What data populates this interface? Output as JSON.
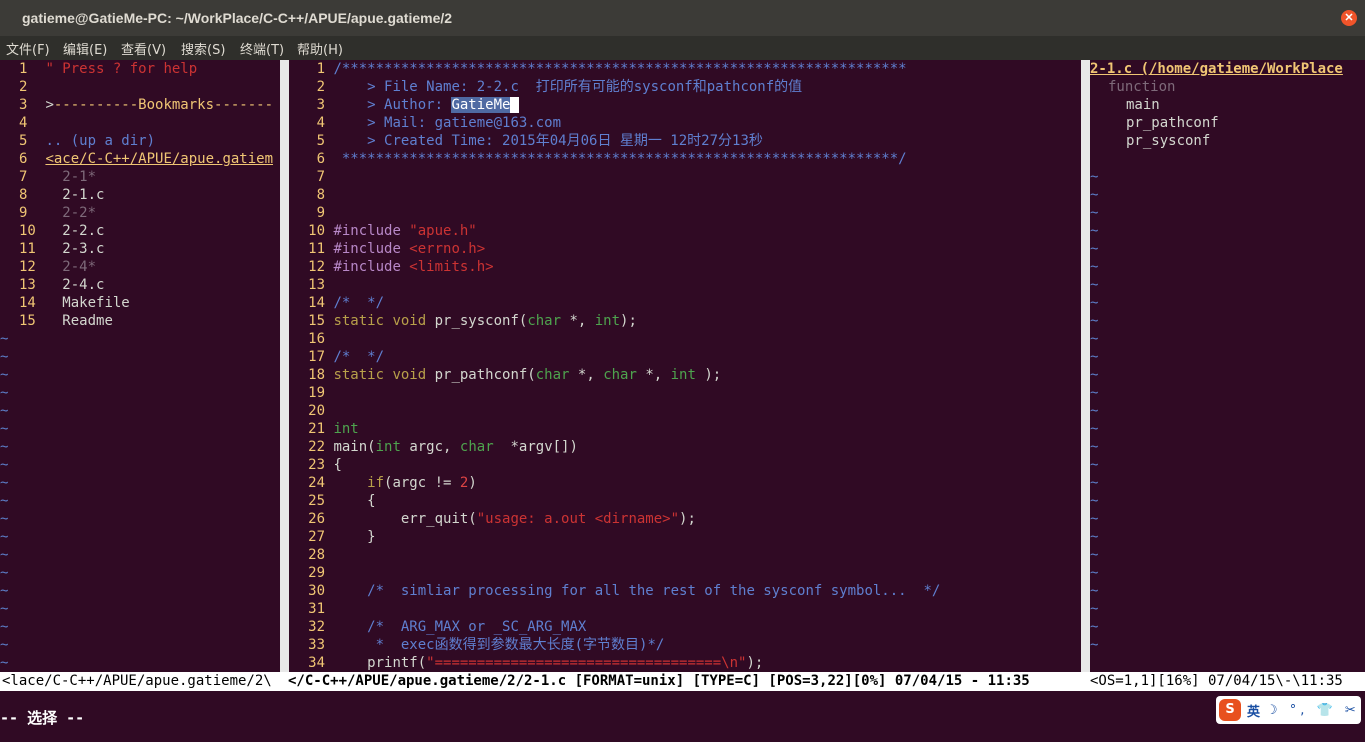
{
  "window": {
    "title": "gatieme@GatieMe-PC: ~/WorkPlace/C-C++/APUE/apue.gatieme/2"
  },
  "menu": [
    "文件(F)",
    "编辑(E)",
    "查看(V)",
    "搜索(S)",
    "终端(T)",
    "帮助(H)"
  ],
  "left_pane": {
    "lines": [
      {
        "n": "1",
        "segs": [
          {
            "t": "\" Press ? for help",
            "c": "str"
          }
        ]
      },
      {
        "n": "2",
        "segs": []
      },
      {
        "n": "3",
        "segs": [
          {
            "t": ">",
            "c": ""
          },
          {
            "t": "----------Bookmarks-------",
            "c": "bookmarks"
          }
        ]
      },
      {
        "n": "4",
        "segs": []
      },
      {
        "n": "5",
        "segs": [
          {
            "t": ".. (up a dir)",
            "c": "cmt"
          }
        ]
      },
      {
        "n": "6",
        "segs": [
          {
            "t": "<ace/C-C++/APUE/apue.gatiem",
            "c": "udir"
          }
        ]
      },
      {
        "n": "7",
        "segs": [
          {
            "t": "  2-1*",
            "c": "dim"
          }
        ]
      },
      {
        "n": "8",
        "segs": [
          {
            "t": "  2-1.c",
            "c": ""
          }
        ]
      },
      {
        "n": "9",
        "segs": [
          {
            "t": "  2-2*",
            "c": "dim"
          }
        ]
      },
      {
        "n": "10",
        "segs": [
          {
            "t": "  2-2.c",
            "c": ""
          }
        ]
      },
      {
        "n": "11",
        "segs": [
          {
            "t": "  2-3.c",
            "c": ""
          }
        ]
      },
      {
        "n": "12",
        "segs": [
          {
            "t": "  2-4*",
            "c": "dim"
          }
        ]
      },
      {
        "n": "13",
        "segs": [
          {
            "t": "  2-4.c",
            "c": ""
          }
        ]
      },
      {
        "n": "14",
        "segs": [
          {
            "t": "  Makefile",
            "c": ""
          }
        ]
      },
      {
        "n": "15",
        "segs": [
          {
            "t": "  Readme",
            "c": ""
          }
        ]
      }
    ]
  },
  "center_pane": {
    "lines": [
      {
        "n": "1",
        "segs": [
          {
            "t": "/*******************************************************************",
            "c": "cmt"
          }
        ]
      },
      {
        "n": "2",
        "segs": [
          {
            "t": "    > File Name: 2-2.c  打印所有可能的sysconf和pathconf的值",
            "c": "cmt"
          }
        ]
      },
      {
        "n": "3",
        "segs": [
          {
            "t": "    > Author: ",
            "c": "cmt"
          },
          {
            "t": "GatieMe",
            "c": "sel"
          },
          {
            "t": " ",
            "c": "cursor"
          }
        ]
      },
      {
        "n": "4",
        "segs": [
          {
            "t": "    > Mail: gatieme@163.com",
            "c": "cmt"
          }
        ]
      },
      {
        "n": "5",
        "segs": [
          {
            "t": "    > Created Time: 2015年04月06日 星期一 12时27分13秒",
            "c": "cmt"
          }
        ]
      },
      {
        "n": "6",
        "segs": [
          {
            "t": " ******************************************************************/",
            "c": "cmt"
          }
        ]
      },
      {
        "n": "7",
        "segs": []
      },
      {
        "n": "8",
        "segs": []
      },
      {
        "n": "9",
        "segs": []
      },
      {
        "n": "10",
        "segs": [
          {
            "t": "#include ",
            "c": "pre"
          },
          {
            "t": "\"apue.h\"",
            "c": "str"
          }
        ]
      },
      {
        "n": "11",
        "segs": [
          {
            "t": "#include ",
            "c": "pre"
          },
          {
            "t": "<errno.h>",
            "c": "str"
          }
        ]
      },
      {
        "n": "12",
        "segs": [
          {
            "t": "#include ",
            "c": "pre"
          },
          {
            "t": "<limits.h>",
            "c": "str"
          }
        ]
      },
      {
        "n": "13",
        "segs": []
      },
      {
        "n": "14",
        "segs": [
          {
            "t": "/*  */",
            "c": "cmt"
          }
        ]
      },
      {
        "n": "15",
        "segs": [
          {
            "t": "static void ",
            "c": "kw"
          },
          {
            "t": "pr_sysconf(",
            "c": ""
          },
          {
            "t": "char",
            "c": "typ"
          },
          {
            "t": " *, ",
            "c": ""
          },
          {
            "t": "int",
            "c": "typ"
          },
          {
            "t": ");",
            "c": ""
          }
        ]
      },
      {
        "n": "16",
        "segs": []
      },
      {
        "n": "17",
        "segs": [
          {
            "t": "/*  */",
            "c": "cmt"
          }
        ]
      },
      {
        "n": "18",
        "segs": [
          {
            "t": "static void ",
            "c": "kw"
          },
          {
            "t": "pr_pathconf(",
            "c": ""
          },
          {
            "t": "char",
            "c": "typ"
          },
          {
            "t": " *, ",
            "c": ""
          },
          {
            "t": "char",
            "c": "typ"
          },
          {
            "t": " *, ",
            "c": ""
          },
          {
            "t": "int",
            "c": "typ"
          },
          {
            "t": " );",
            "c": ""
          }
        ]
      },
      {
        "n": "19",
        "segs": []
      },
      {
        "n": "20",
        "segs": []
      },
      {
        "n": "21",
        "segs": [
          {
            "t": "int",
            "c": "typ"
          }
        ]
      },
      {
        "n": "22",
        "segs": [
          {
            "t": "main(",
            "c": ""
          },
          {
            "t": "int",
            "c": "typ"
          },
          {
            "t": " argc, ",
            "c": ""
          },
          {
            "t": "char",
            "c": "typ"
          },
          {
            "t": "  *argv[])",
            "c": ""
          }
        ]
      },
      {
        "n": "23",
        "segs": [
          {
            "t": "{",
            "c": ""
          }
        ]
      },
      {
        "n": "24",
        "segs": [
          {
            "t": "    ",
            "c": ""
          },
          {
            "t": "if",
            "c": "kw"
          },
          {
            "t": "(argc != ",
            "c": ""
          },
          {
            "t": "2",
            "c": "num"
          },
          {
            "t": ")",
            "c": ""
          }
        ]
      },
      {
        "n": "25",
        "segs": [
          {
            "t": "    {",
            "c": ""
          }
        ]
      },
      {
        "n": "26",
        "segs": [
          {
            "t": "        err_quit(",
            "c": ""
          },
          {
            "t": "\"usage: a.out <dirname>\"",
            "c": "str"
          },
          {
            "t": ");",
            "c": ""
          }
        ]
      },
      {
        "n": "27",
        "segs": [
          {
            "t": "    }",
            "c": ""
          }
        ]
      },
      {
        "n": "28",
        "segs": []
      },
      {
        "n": "29",
        "segs": []
      },
      {
        "n": "30",
        "segs": [
          {
            "t": "    /*  simliar processing for all the rest of the sysconf symbol...  */",
            "c": "cmt"
          }
        ]
      },
      {
        "n": "31",
        "segs": []
      },
      {
        "n": "32",
        "segs": [
          {
            "t": "    /*  ARG_MAX or _SC_ARG_MAX",
            "c": "cmt"
          }
        ]
      },
      {
        "n": "33",
        "segs": [
          {
            "t": "     *  exec函数得到参数最大长度(字节数目)*/",
            "c": "cmt"
          }
        ]
      },
      {
        "n": "34",
        "segs": [
          {
            "t": "    printf(",
            "c": ""
          },
          {
            "t": "\"==================================\\n\"",
            "c": "str"
          },
          {
            "t": ");",
            "c": ""
          }
        ]
      }
    ]
  },
  "right_pane": {
    "header": "2-1.c (/home/gatieme/WorkPlace",
    "kind": "function",
    "tags": [
      "main",
      "pr_pathconf",
      "pr_sysconf"
    ]
  },
  "status": {
    "left": "<lace/C-C++/APUE/apue.gatieme/2\\",
    "center": "</C-C++/APUE/apue.gatieme/2/2-1.c [FORMAT=unix] [TYPE=C] [POS=3,22][0%] 07/04/15 - 11:35",
    "right": "<OS=1,1][16%] 07/04/15\\-\\11:35"
  },
  "cmdline": "-- 选择 --",
  "ime": {
    "logo": "S",
    "lang": "英",
    "icons": "☽ °, 👕 ✂"
  },
  "colors": {
    "terminal_bg": "#300a24",
    "line_number": "#f0c674",
    "comment": "#5f7fd0",
    "string": "#cc3333",
    "keyword": "#b8a04a",
    "type": "#4ea34e"
  }
}
